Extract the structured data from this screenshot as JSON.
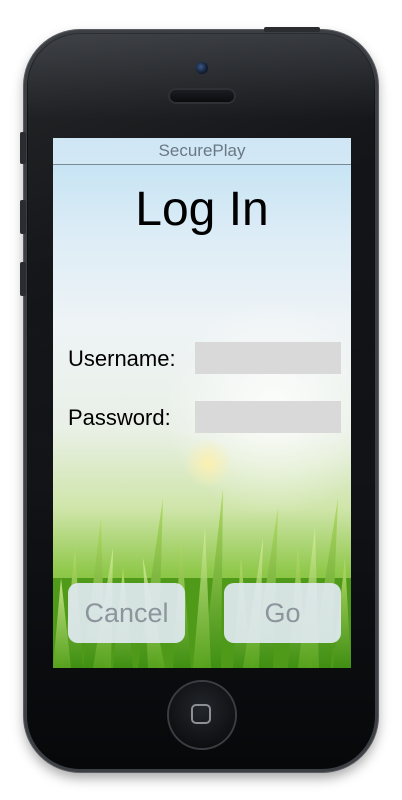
{
  "app": {
    "header_title": "SecurePlay",
    "page_title": "Log In"
  },
  "form": {
    "username_label": "Username:",
    "username_value": "",
    "password_label": "Password:",
    "password_value": ""
  },
  "actions": {
    "cancel_label": "Cancel",
    "go_label": "Go"
  },
  "colors": {
    "field_background": "#d9d9d9",
    "button_background": "#e1e9f2",
    "button_text": "#8c949c",
    "header_text": "#6a7884"
  }
}
